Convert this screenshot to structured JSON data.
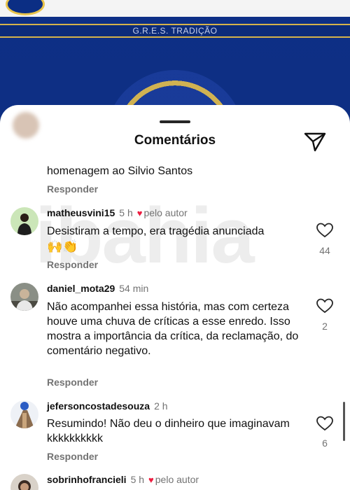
{
  "background": {
    "band_label": "G.R.E.S. TRADIÇÃO"
  },
  "sheet": {
    "title": "Comentários"
  },
  "watermark": "ibahia",
  "reply_label": "Responder",
  "author_label": "pelo autor",
  "first_comment": {
    "visible_text_line1": "homenagem ao Silvio Santos"
  },
  "comments": [
    {
      "username": "matheusvini15",
      "time": "5 h",
      "liked_by_author": true,
      "text": "Desistiram a tempo, era tragédia anunciada",
      "emoji": "🙌👏",
      "likes": "44"
    },
    {
      "username": "daniel_mota29",
      "time": "54 min",
      "liked_by_author": false,
      "text": "Não acompanhei essa história, mas com certeza houve uma chuva de críticas a esse enredo. Isso mostra a importância da crítica, da reclamação, do comentário negativo.",
      "likes": "2"
    },
    {
      "username": "jefersoncostadesouza",
      "time": "2 h",
      "liked_by_author": false,
      "text": "Resumindo! Não deu o dinheiro que imaginavam kkkkkkkkkk",
      "likes": "6"
    },
    {
      "username": "sobrinhofrancieli",
      "time": "5 h",
      "liked_by_author": true
    }
  ],
  "colors": {
    "heart": "#ed1c3f",
    "muted": "#737373"
  }
}
